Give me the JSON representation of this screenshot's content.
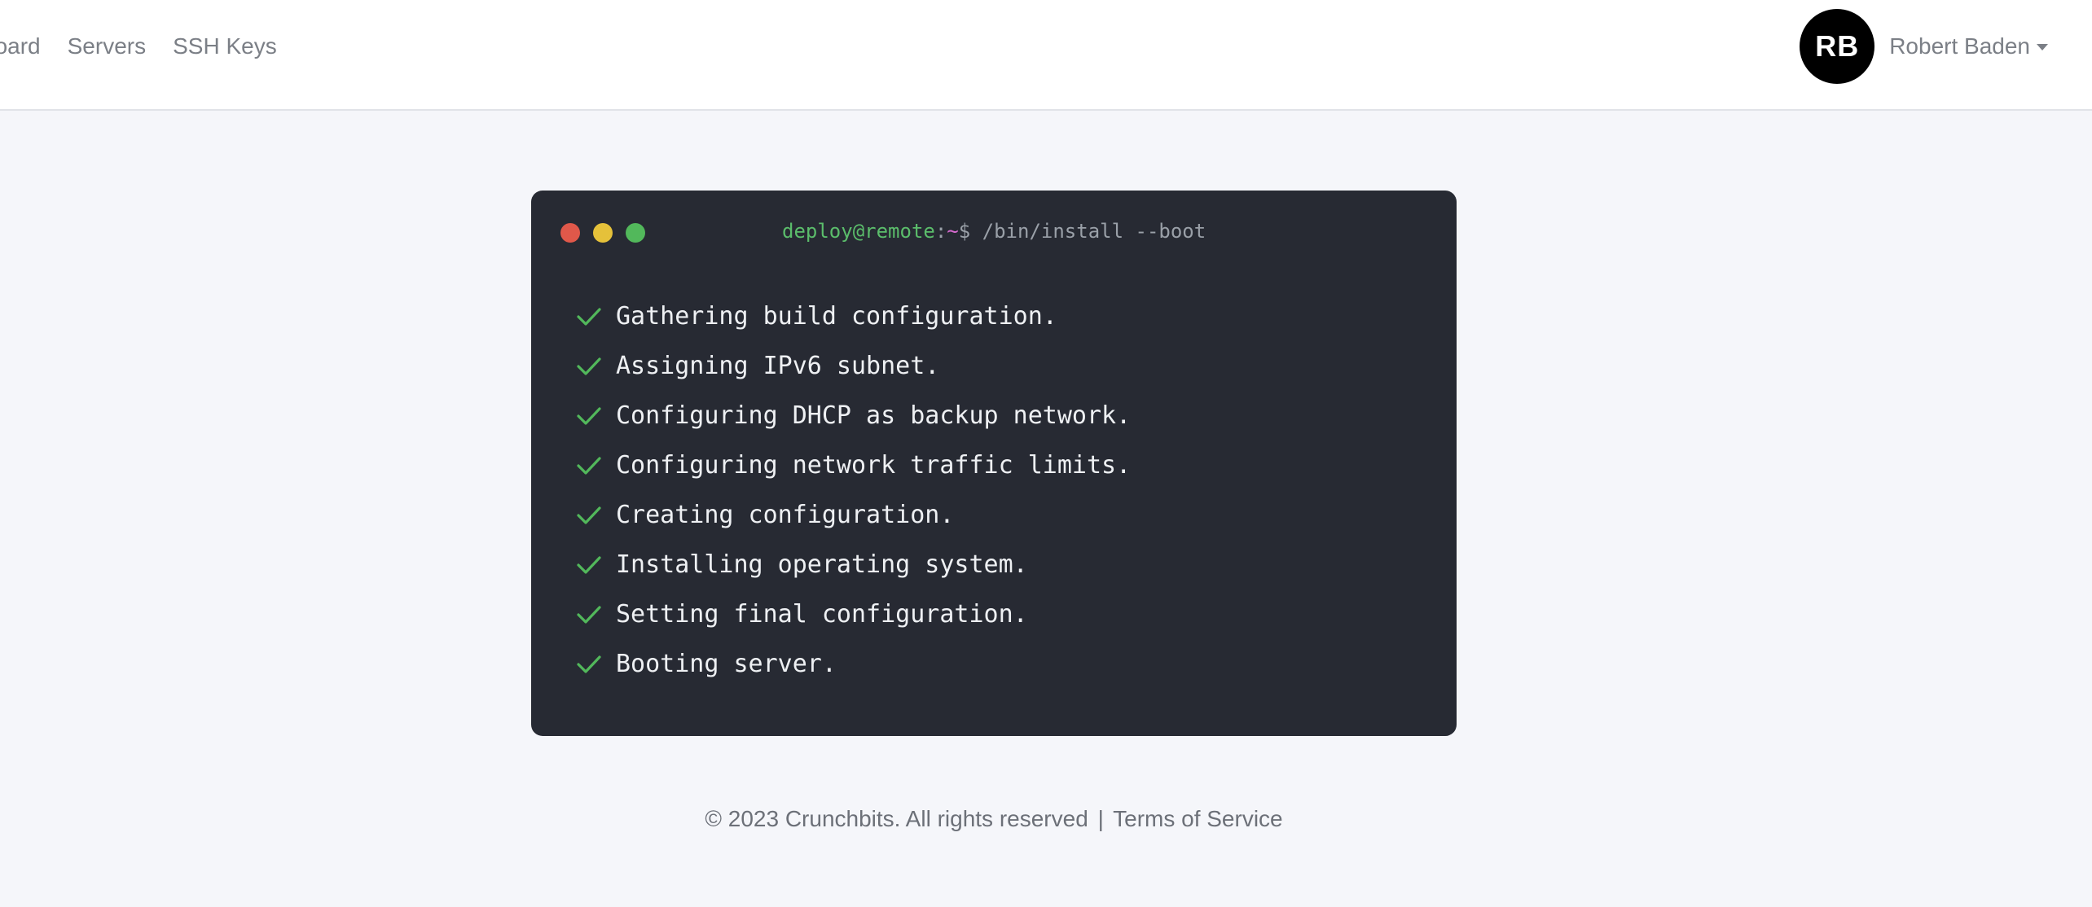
{
  "nav": {
    "links": [
      {
        "label": "Dashboard",
        "visible_label": "board"
      },
      {
        "label": "Servers"
      },
      {
        "label": "SSH Keys"
      }
    ]
  },
  "user": {
    "initials": "RB",
    "name": "Robert Baden"
  },
  "terminal": {
    "prompt_user": "deploy@remote",
    "prompt_colon": ":",
    "prompt_path": "~",
    "prompt_symbol": "$",
    "command": " /bin/install --boot",
    "steps": [
      "Gathering build configuration.",
      "Assigning IPv6 subnet.",
      "Configuring DHCP as backup network.",
      "Configuring network traffic limits.",
      "Creating configuration.",
      "Installing operating system.",
      "Setting final configuration.",
      "Booting server."
    ],
    "step_icon": "check-icon",
    "colors": {
      "background": "#272a33",
      "check": "#52b85b",
      "prompt_user": "#5bbd6b",
      "prompt_path": "#d86bd0"
    }
  },
  "footer": {
    "copyright": "© 2023 Crunchbits. All rights reserved",
    "separator": "|",
    "terms_label": "Terms of Service"
  }
}
